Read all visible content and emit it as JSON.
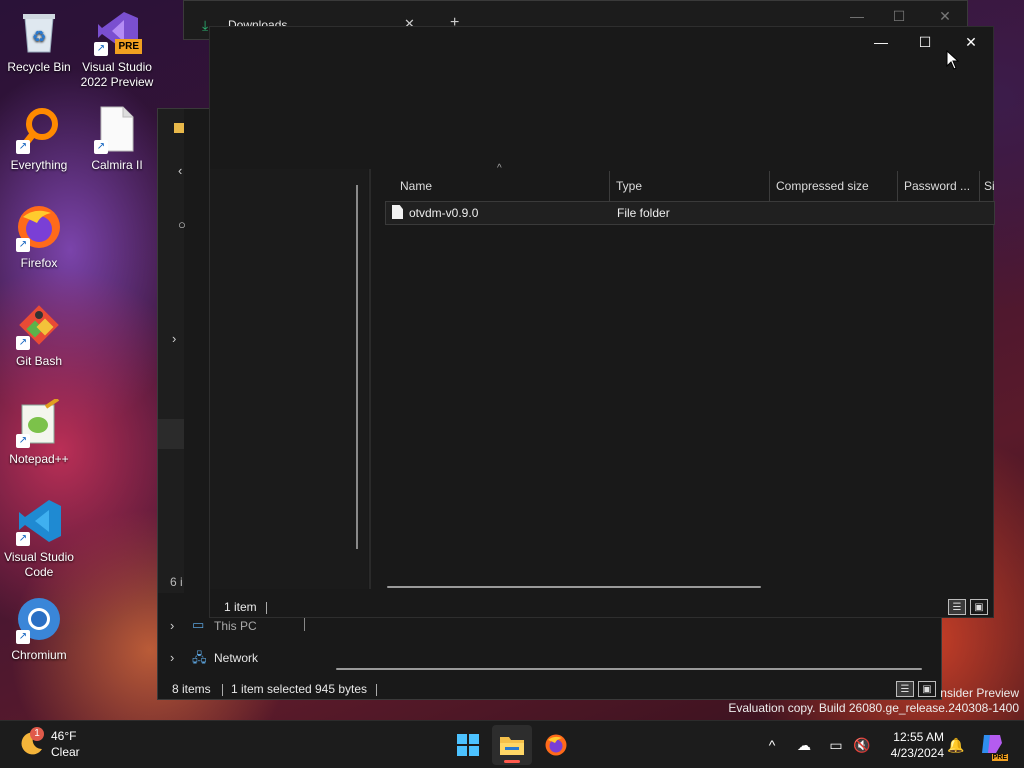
{
  "desktop": {
    "icons": [
      {
        "label": "Recycle Bin",
        "icon": "recycle-bin-icon"
      },
      {
        "label": "Visual Studio 2022 Preview",
        "icon": "visual-studio-preview-icon",
        "badge": "PRE"
      },
      {
        "label": "Everything",
        "icon": "everything-search-icon"
      },
      {
        "label": "Calmira II",
        "icon": "blank-file-icon"
      },
      {
        "label": "Firefox",
        "icon": "firefox-icon"
      },
      {
        "label": "Git Bash",
        "icon": "git-bash-icon"
      },
      {
        "label": "Notepad++",
        "icon": "notepad-plus-plus-icon"
      },
      {
        "label": "Visual Studio Code",
        "icon": "vscode-icon"
      },
      {
        "label": "Chromium",
        "icon": "chromium-icon"
      }
    ]
  },
  "downloads_window": {
    "tab_title": "Downloads",
    "new_tab": "+"
  },
  "explorer_behind": {
    "nav_items": [
      {
        "label": "This PC",
        "icon": "pc-icon"
      },
      {
        "label": "Network",
        "icon": "network-icon"
      }
    ],
    "status": {
      "items": "8 items",
      "selected": "1 item selected",
      "size": "945 bytes"
    },
    "partial_count": "6 i"
  },
  "archive_window": {
    "columns": [
      "Name",
      "Type",
      "Compressed size",
      "Password ...",
      "Si"
    ],
    "rows": [
      {
        "name": "otvdm-v0.9.0",
        "type": "File folder",
        "icon": "folder-file-icon"
      }
    ],
    "status": {
      "items": "1 item"
    }
  },
  "watermark": {
    "line1": "nsider Preview",
    "line2": "Evaluation copy. Build 26080.ge_release.240308-1400"
  },
  "taskbar": {
    "weather": {
      "temp": "46°F",
      "condition": "Clear",
      "badge": "1"
    },
    "clock": {
      "time": "12:55 AM",
      "date": "4/23/2024"
    },
    "copilot_badge": "PRE"
  },
  "colors": {
    "accent": "#0078d4",
    "window_bg": "#191919",
    "taskbar_bg": "#1c1c1c"
  }
}
